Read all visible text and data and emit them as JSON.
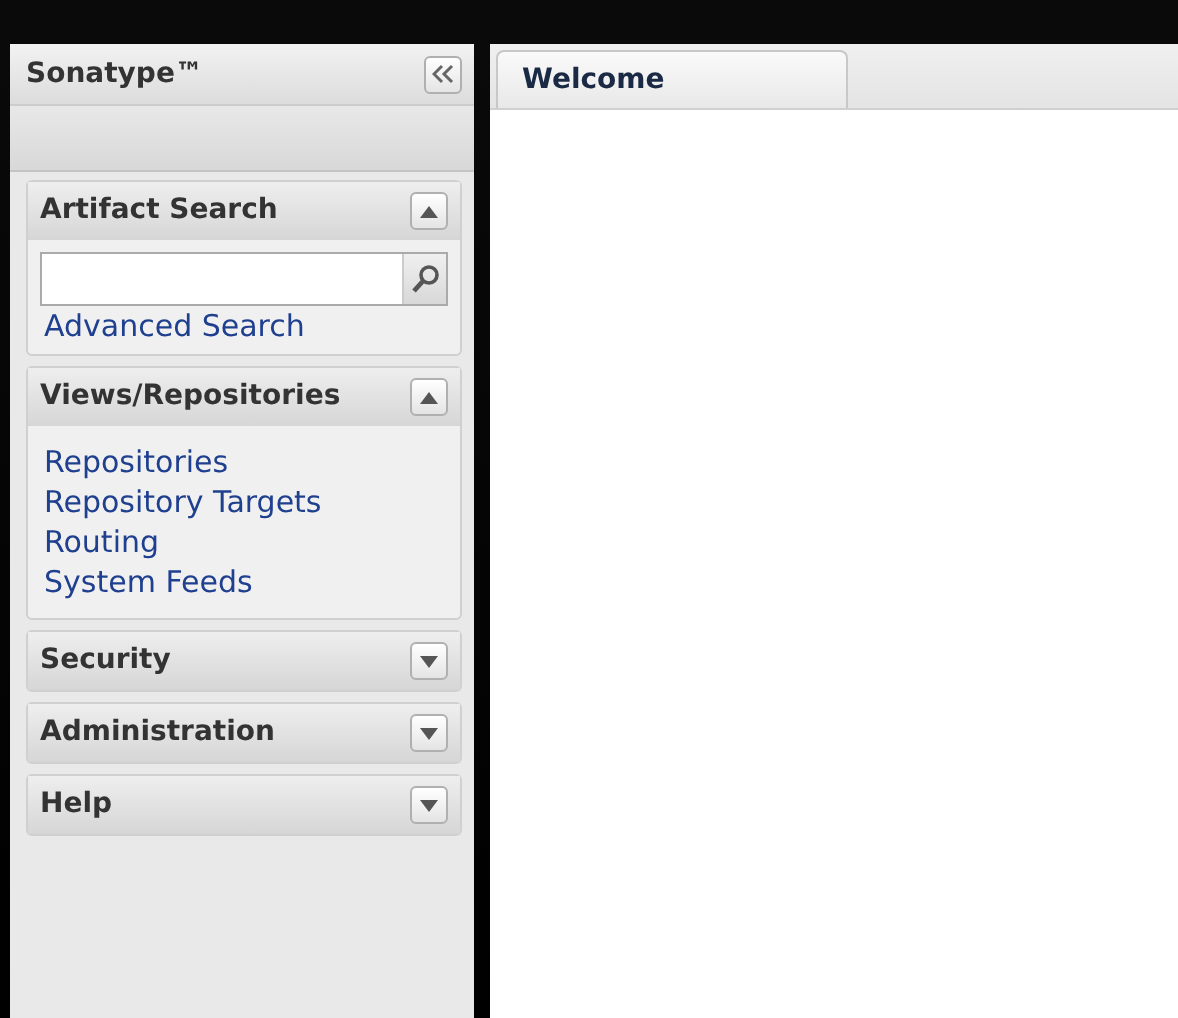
{
  "sidebar": {
    "title": "Sonatype™",
    "panels": [
      {
        "title": "Artifact Search",
        "expanded": true,
        "kind": "search",
        "links": [
          "Advanced Search"
        ]
      },
      {
        "title": "Views/Repositories",
        "expanded": true,
        "kind": "links",
        "links": [
          "Repositories",
          "Repository Targets",
          "Routing",
          "System Feeds"
        ]
      },
      {
        "title": "Security",
        "expanded": false
      },
      {
        "title": "Administration",
        "expanded": false
      },
      {
        "title": "Help",
        "expanded": false
      }
    ]
  },
  "tabs": [
    {
      "label": "Welcome",
      "selected": true
    }
  ]
}
